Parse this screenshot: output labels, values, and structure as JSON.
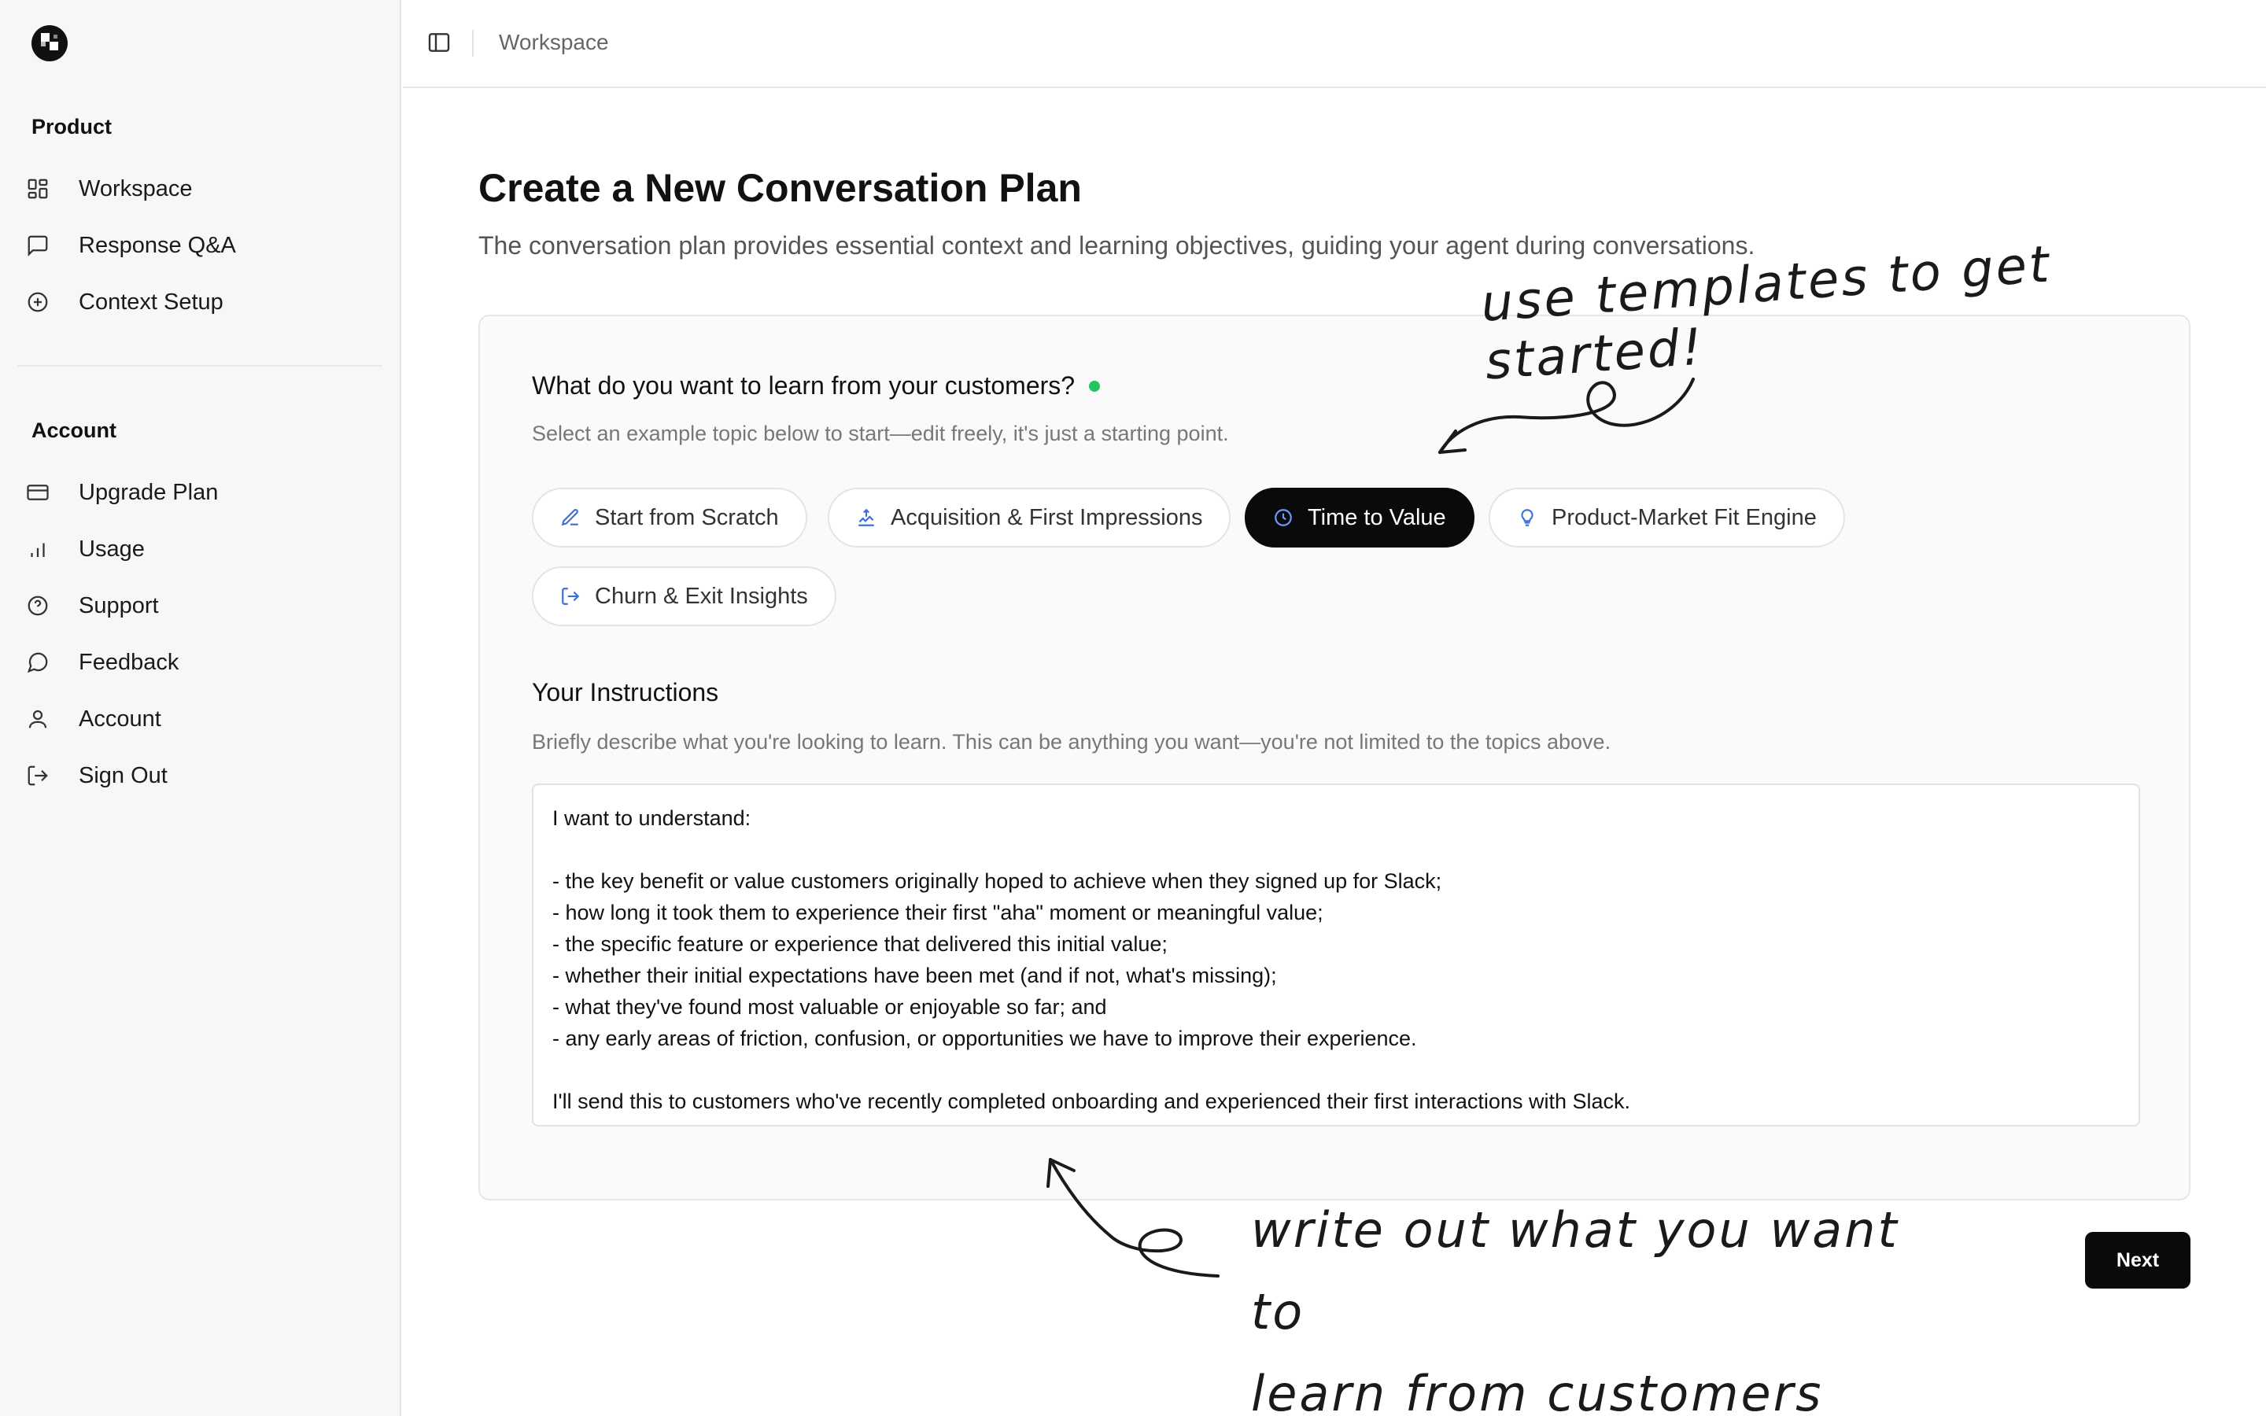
{
  "sidebar": {
    "sections": [
      {
        "label": "Product",
        "items": [
          {
            "label": "Workspace",
            "icon": "grid-icon"
          },
          {
            "label": "Response Q&A",
            "icon": "message-square-icon"
          },
          {
            "label": "Context Setup",
            "icon": "plus-circle-icon"
          }
        ]
      },
      {
        "label": "Account",
        "items": [
          {
            "label": "Upgrade Plan",
            "icon": "credit-card-icon"
          },
          {
            "label": "Usage",
            "icon": "bar-chart-icon"
          },
          {
            "label": "Support",
            "icon": "help-circle-icon"
          },
          {
            "label": "Feedback",
            "icon": "message-circle-icon"
          },
          {
            "label": "Account",
            "icon": "user-icon"
          },
          {
            "label": "Sign Out",
            "icon": "log-out-icon"
          }
        ]
      }
    ]
  },
  "header": {
    "breadcrumb": "Workspace"
  },
  "main": {
    "title": "Create a New Conversation Plan",
    "subtitle": "The conversation plan provides essential context and learning objectives, guiding your agent during conversations.",
    "question": "What do you want to learn from your customers?",
    "question_hint": "Select an example topic below to start—edit freely, it's just a starting point.",
    "templates": [
      {
        "label": "Start from Scratch",
        "icon": "pencil-icon",
        "active": false
      },
      {
        "label": "Acquisition & First Impressions",
        "icon": "upload-icon",
        "active": false
      },
      {
        "label": "Time to Value",
        "icon": "clock-icon",
        "active": true
      },
      {
        "label": "Product-Market Fit Engine",
        "icon": "lightbulb-icon",
        "active": false
      },
      {
        "label": "Churn & Exit Insights",
        "icon": "log-out-icon",
        "active": false
      }
    ],
    "instructions_title": "Your Instructions",
    "instructions_hint": "Briefly describe what you're looking to learn. This can be anything you want—you're not limited to the topics above.",
    "instructions_value": "I want to understand:\n\n- the key benefit or value customers originally hoped to achieve when they signed up for Slack;\n- how long it took them to experience their first \"aha\" moment or meaningful value;\n- the specific feature or experience that delivered this initial value;\n- whether their initial expectations have been met (and if not, what's missing);\n- what they've found most valuable or enjoyable so far; and\n- any early areas of friction, confusion, or opportunities we have to improve their experience.\n\nI'll send this to customers who've recently completed onboarding and experienced their first interactions with Slack.",
    "next_label": "Next"
  },
  "annotations": {
    "top": "use templates to get started!",
    "bottom_line1": "write out what you want to",
    "bottom_line2": "learn from customers"
  },
  "colors": {
    "accent": "#0a0a0a",
    "status_dot": "#22c55e",
    "icon_blue": "#3b6fd8"
  }
}
